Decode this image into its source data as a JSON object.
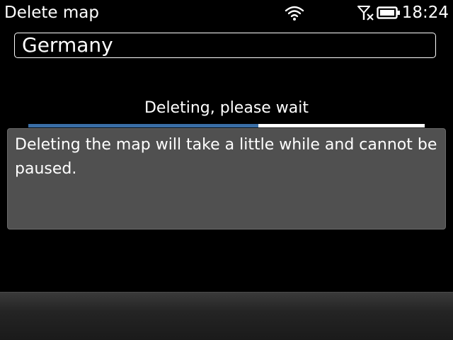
{
  "window": {
    "title": "Delete map"
  },
  "status_bar": {
    "time": "18:24",
    "icons": [
      "wifi-icon",
      "no-signal-icon",
      "battery-icon"
    ]
  },
  "map": {
    "name": "Germany"
  },
  "progress": {
    "label": "Deleting, please wait",
    "fraction": 0.58,
    "fill_color": "#3a6ea5",
    "track_color": "#ffffff"
  },
  "info": {
    "message": "Deleting the map will take a little while and cannot be paused."
  }
}
